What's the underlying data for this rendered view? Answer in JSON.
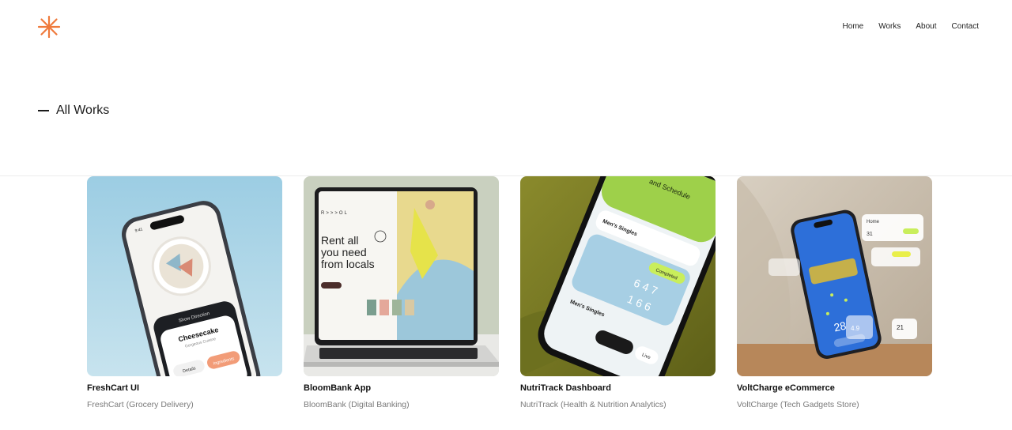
{
  "brand": {
    "logo_icon": "asterisk-logo-icon",
    "accent": "#ef7a3c"
  },
  "nav": {
    "items": [
      "Home",
      "Works",
      "About",
      "Contact"
    ]
  },
  "section": {
    "title": "All Works"
  },
  "works": [
    {
      "title": "FreshCart UI",
      "subtitle": "FreshCart (Grocery Delivery)",
      "mock": {
        "screen_title": "Cheesecake",
        "screen_sub": "Gorgeous Cuisine",
        "button_primary": "Ingredients",
        "button_secondary": "Details",
        "banner": "Show Direction",
        "time": "9:41"
      }
    },
    {
      "title": "BloomBank App",
      "subtitle": "BloomBank (Digital Banking)",
      "mock": {
        "headline_1": "Rent all",
        "headline_2": "you need",
        "headline_3": "from locals",
        "brand_mark": "R>>>OL"
      }
    },
    {
      "title": "NutriTrack Dashboard",
      "subtitle": "NutriTrack (Health & Nutrition Analytics)",
      "mock": {
        "header": "and Schedule",
        "row_1": "Men's Singles",
        "status": "Completed",
        "row_2": "Men's Singles",
        "pill": "Live",
        "score_a": "6 4 7",
        "score_b": "1 6 6"
      }
    },
    {
      "title": "VoltCharge eCommerce",
      "subtitle": "VoltCharge (Tech Gadgets Store)",
      "mock": {
        "widget_title": "Home",
        "temp_1": "28",
        "temp_2": "21",
        "stat_1": "4.9",
        "stat_2": "31"
      }
    }
  ]
}
